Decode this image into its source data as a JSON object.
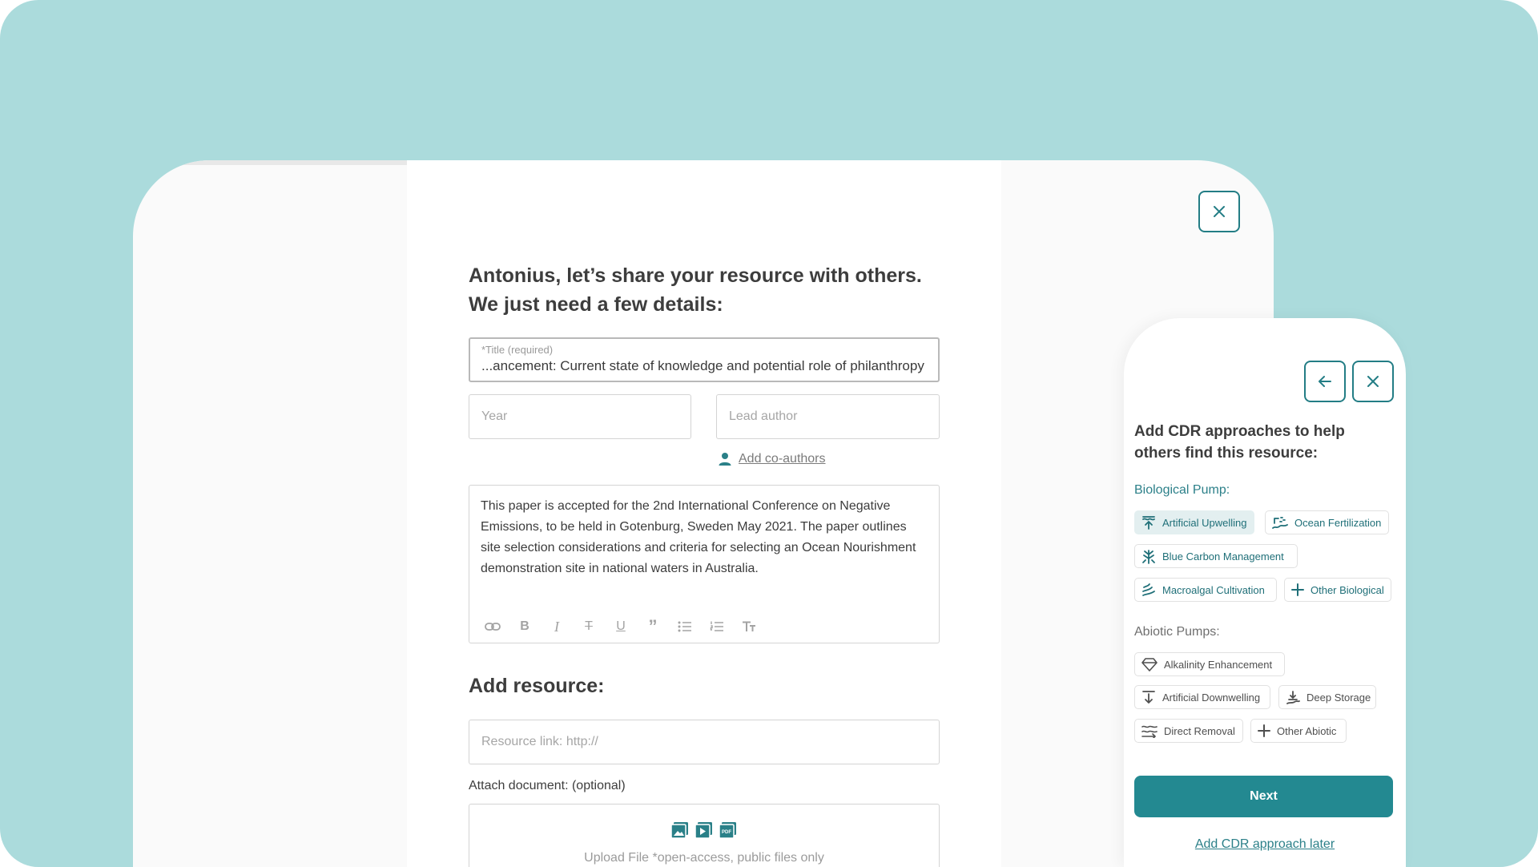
{
  "form": {
    "heading_line1": "Antonius, let’s share your resource with others.",
    "heading_line2": "We just need a few details:",
    "title_label": "*Title (required)",
    "title_value": "...ancement: Current state of knowledge and potential role of philanthropy",
    "year_placeholder": "Year",
    "lead_author_placeholder": "Lead author",
    "add_coauthors": "Add co-authors",
    "description": "This paper is accepted for the 2nd International Conference on Negative Emissions, to be held in Gotenburg, Sweden May 2021. The paper outlines site selection considerations and criteria for selecting an Ocean Nourishment demonstration site in national waters in Australia.",
    "toolbar_icons": [
      "link-icon",
      "bold-icon",
      "italic-icon",
      "strikethrough-icon",
      "underline-icon",
      "quote-icon",
      "bulleted-list-icon",
      "numbered-list-icon",
      "text-size-icon"
    ],
    "add_resource_heading": "Add resource:",
    "resource_link_placeholder": "Resource link: http://",
    "attach_label": "Attach document: (optional)",
    "upload_text": "Upload File *open-access, public files only"
  },
  "mobile": {
    "title_line1": "Add CDR approaches to help",
    "title_line2": "others find this resource:",
    "biological_label": "Biological Pump:",
    "biological_chips": [
      "Artificial Upwelling",
      "Ocean Fertilization",
      "Blue Carbon Management",
      "Macroalgal Cultivation",
      "Other Biological"
    ],
    "abiotic_label": "Abiotic Pumps:",
    "abiotic_chips": [
      "Alkalinity Enhancement",
      "Artificial Downwelling",
      "Deep Storage",
      "Direct Removal",
      "Other Abiotic"
    ],
    "next_label": "Next",
    "later_label": "Add CDR approach later"
  },
  "colors": {
    "background": "#abdbdc",
    "accent": "#238991",
    "accent_dark": "#1f6f78"
  }
}
